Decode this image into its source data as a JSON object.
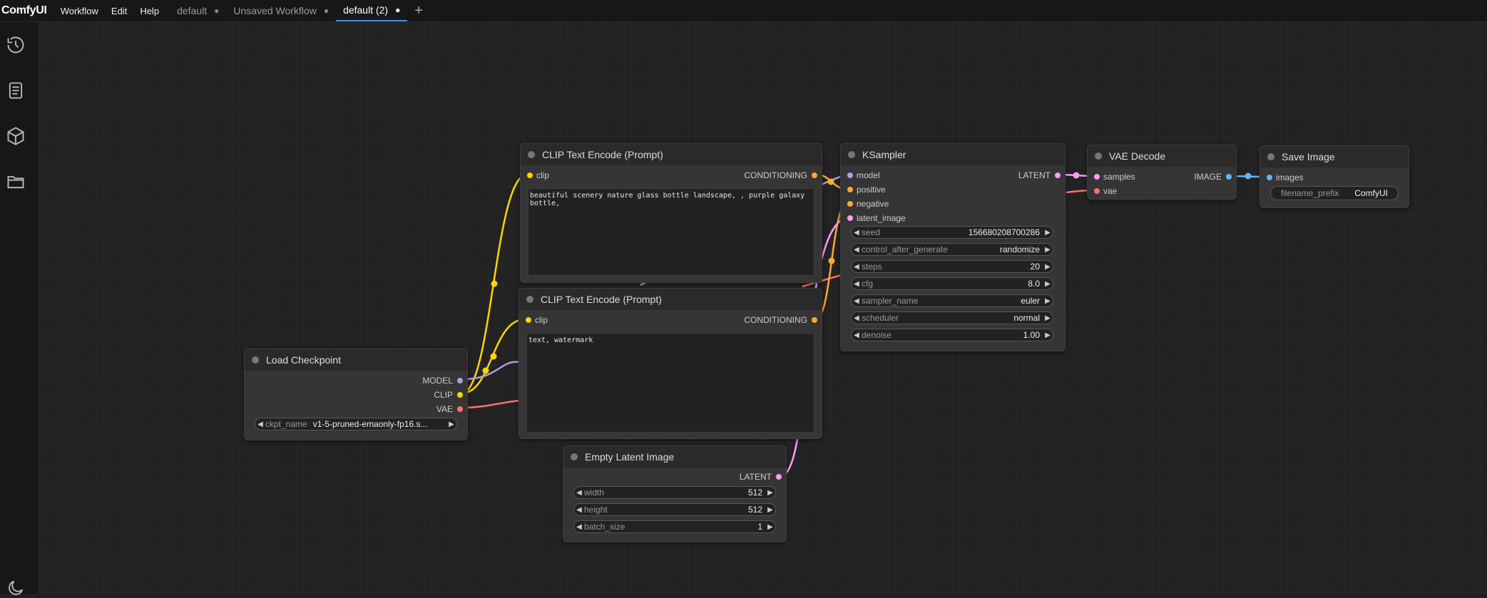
{
  "app": {
    "logo": "ComfyUI"
  },
  "menu": [
    "Workflow",
    "Edit",
    "Help"
  ],
  "tabs": [
    {
      "label": "default",
      "marker": "●"
    },
    {
      "label": "Unsaved Workflow",
      "marker": "●"
    },
    {
      "label": "default (2)",
      "marker": "●"
    }
  ],
  "add_tab": "+",
  "sidebar_icons": [
    "history-icon",
    "queue-list-icon",
    "node-library-cube-icon",
    "workflows-folder-icon",
    "theme-moon-icon"
  ],
  "colors": {
    "clip": "#ffd500",
    "model": "#b39ddb",
    "vae": "#ff6e6e",
    "conditioning": "#ffa931",
    "latent": "#ff9cf9",
    "image": "#64b5f6",
    "accent": "#4a8cd6"
  },
  "nodes": {
    "clip_pos": {
      "title": "CLIP Text Encode (Prompt)",
      "input": "clip",
      "output": "CONDITIONING",
      "text": "beautiful scenery nature glass bottle landscape, , purple galaxy bottle,"
    },
    "clip_neg": {
      "title": "CLIP Text Encode (Prompt)",
      "input": "clip",
      "output": "CONDITIONING",
      "text": "text, watermark"
    },
    "ksampler": {
      "title": "KSampler",
      "inputs": [
        "model",
        "positive",
        "negative",
        "latent_image"
      ],
      "output": "LATENT",
      "widgets": [
        {
          "label": "seed",
          "value": "156680208700286"
        },
        {
          "label": "control_after_generate",
          "value": "randomize"
        },
        {
          "label": "steps",
          "value": "20"
        },
        {
          "label": "cfg",
          "value": "8.0"
        },
        {
          "label": "sampler_name",
          "value": "euler"
        },
        {
          "label": "scheduler",
          "value": "normal"
        },
        {
          "label": "denoise",
          "value": "1.00"
        }
      ]
    },
    "vae_decode": {
      "title": "VAE Decode",
      "inputs": [
        "samples",
        "vae"
      ],
      "output": "IMAGE"
    },
    "save_image": {
      "title": "Save Image",
      "input": "images",
      "widget": {
        "label": "filename_prefix",
        "value": "ComfyUI"
      }
    },
    "load_checkpoint": {
      "title": "Load Checkpoint",
      "outputs": [
        "MODEL",
        "CLIP",
        "VAE"
      ],
      "widget": {
        "label": "ckpt_name",
        "value": "v1-5-pruned-emaonly-fp16.s..."
      }
    },
    "empty_latent": {
      "title": "Empty Latent Image",
      "output": "LATENT",
      "widgets": [
        {
          "label": "width",
          "value": "512"
        },
        {
          "label": "height",
          "value": "512"
        },
        {
          "label": "batch_size",
          "value": "1"
        }
      ]
    }
  }
}
